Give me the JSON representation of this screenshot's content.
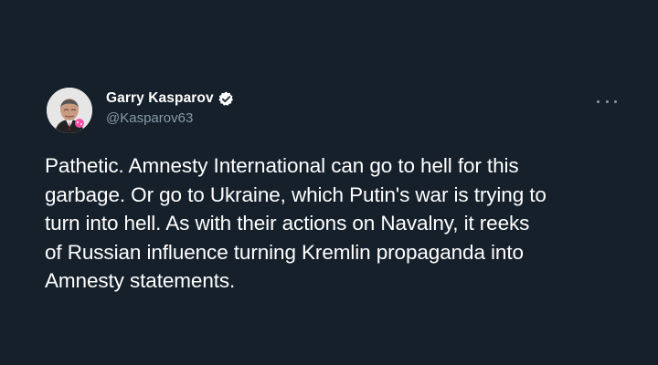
{
  "author": {
    "display_name": "Garry Kasparov",
    "handle": "@Kasparov63",
    "verified": true
  },
  "tweet": {
    "text_lines": [
      "Pathetic. Amnesty International can go to hell for this",
      "garbage. Or go to Ukraine, which Putin's war is trying to",
      "turn into hell. As with their actions on Navalny, it reeks",
      "of Russian influence turning Kremlin propaganda into",
      "Amnesty statements."
    ]
  },
  "icons": {
    "verified": "verified-badge-icon",
    "more": "more-options-icon"
  },
  "colors": {
    "background": "#15202b",
    "text": "#ffffff",
    "secondary_text": "#8899a6"
  }
}
